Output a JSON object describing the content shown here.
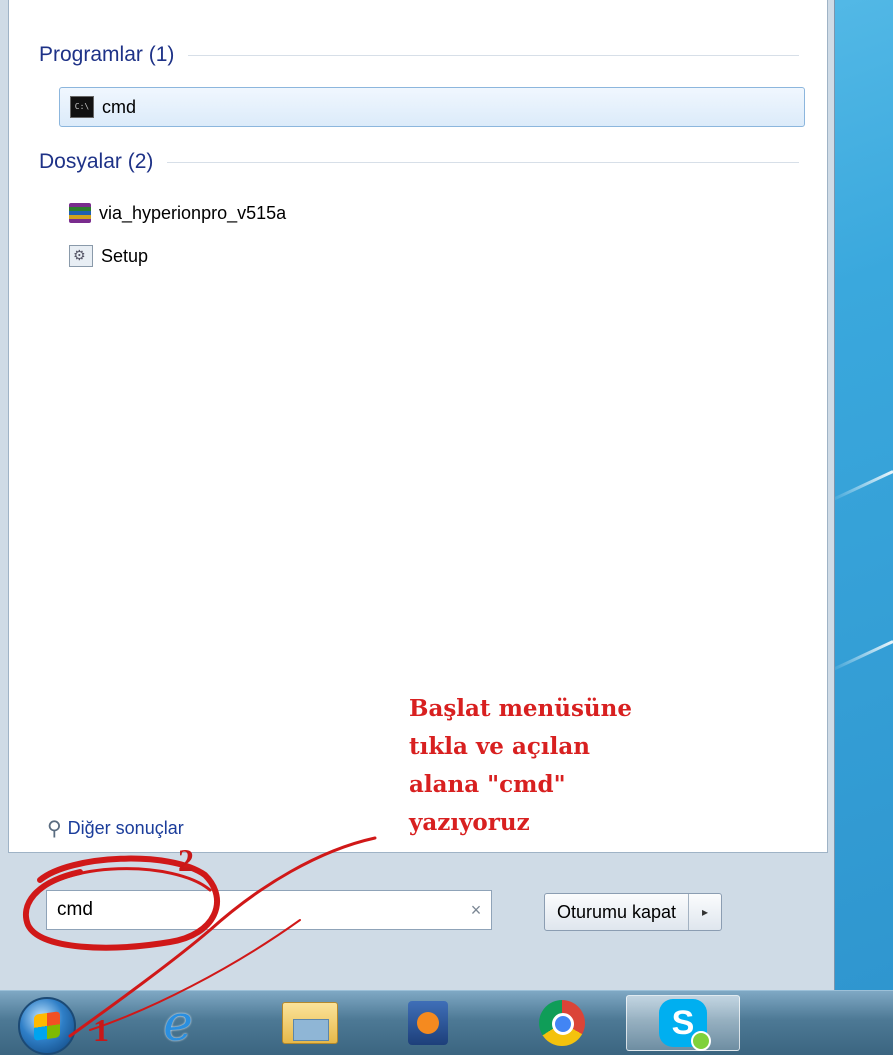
{
  "start_menu": {
    "groups": [
      {
        "label": "Programlar (1)",
        "items": [
          {
            "label": "cmd",
            "icon": "cmd-icon"
          }
        ]
      },
      {
        "label": "Dosyalar (2)",
        "items": [
          {
            "label": "via_hyperionpro_v515a",
            "icon": "winrar-archive-icon"
          },
          {
            "label": "Setup",
            "icon": "setup-file-icon"
          }
        ]
      }
    ],
    "more_results": "Diğer sonuçlar",
    "search": {
      "value": "cmd",
      "clear_icon": "×"
    },
    "shutdown": {
      "label": "Oturumu kapat",
      "arrow": "▸"
    }
  },
  "taskbar": {
    "items": [
      {
        "name": "internet-explorer-icon"
      },
      {
        "name": "windows-explorer-icon"
      },
      {
        "name": "media-player-icon"
      },
      {
        "name": "chrome-icon"
      },
      {
        "name": "skype-icon",
        "glyph": "S"
      }
    ]
  },
  "annotation": {
    "text_lines": [
      "Başlat menüsüne",
      "tıkla ve açılan",
      "alana \"cmd\"",
      "yazıyoruz"
    ],
    "step1": "1",
    "step2": "2",
    "color": "#d82020"
  }
}
